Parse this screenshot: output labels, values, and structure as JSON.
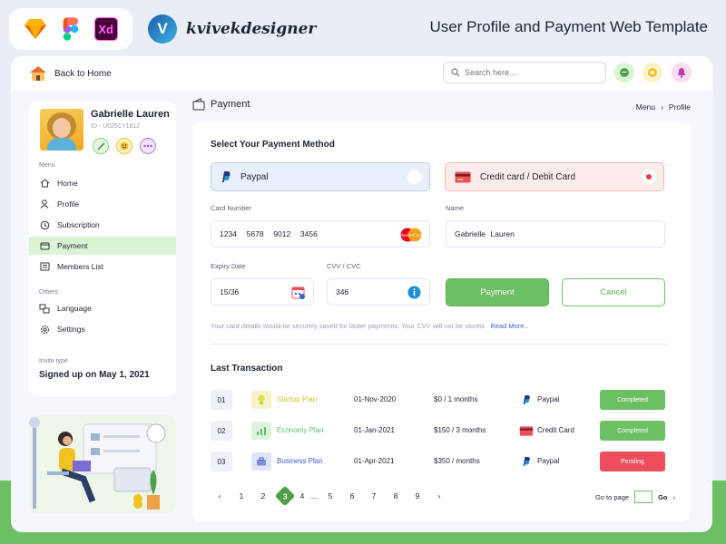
{
  "banner": {
    "tools": [
      "sketch-icon",
      "figma-icon",
      "xd-icon"
    ],
    "xd_label": "Xd",
    "brand_initial": "V",
    "brand_name": "kvivekdesigner",
    "title": "User Profile and Payment Web Template"
  },
  "topbar": {
    "back_label": "Back to Home",
    "search_placeholder": "Search here....",
    "icons": [
      "chat-icon",
      "gear-icon",
      "notification-icon"
    ]
  },
  "sidebar": {
    "user_name": "Gabrielle Lauren",
    "user_id": "ID - U0251Y1812",
    "menu_label": "Menu",
    "items": [
      {
        "label": "Home",
        "icon": "home-icon"
      },
      {
        "label": "Profile",
        "icon": "user-icon"
      },
      {
        "label": "Subscription",
        "icon": "subscription-icon"
      },
      {
        "label": "Payment",
        "icon": "wallet-icon"
      },
      {
        "label": "Members List",
        "icon": "list-icon"
      }
    ],
    "active_index": 3,
    "others_label": "Others",
    "others": [
      {
        "label": "Language",
        "icon": "language-icon"
      },
      {
        "label": "Settings",
        "icon": "gear-icon"
      }
    ],
    "invite_label": "Invite type",
    "invite_value": "Signed up on May 1, 2021"
  },
  "main": {
    "title": "Payment",
    "breadcrumb": [
      "Menu",
      "Profile"
    ],
    "select_method_title": "Select Your Payment Method",
    "methods": {
      "paypal": "Paypal",
      "card": "Credit card / Debit Card"
    },
    "card_number_label": "Card Number",
    "card_number_value": "1234  5678  9012  3456",
    "card_brand": "MasterCard",
    "name_label": "Name",
    "name_value": "Gabrielle Lauren",
    "expiry_label": "Expiry Date",
    "expiry_value": "15/36",
    "cvv_label": "CVV / CVC",
    "cvv_value": "346",
    "pay_button": "Payment",
    "cancel_button": "Cancel",
    "note": "Your card details would be securely saved for faster payments. Your CVV will not be stored.",
    "read_more": "Read More..",
    "last_tx_title": "Last Transaction",
    "transactions": [
      {
        "num": "01",
        "plan": "Startup Plan",
        "date": "01-Nov-2020",
        "amount": "$0 / 1 months",
        "method": "Paypal",
        "status": "Completed"
      },
      {
        "num": "02",
        "plan": "Economy Plan",
        "date": "01-Jan-2021",
        "amount": "$150 / 3 months",
        "method": "Credit Card",
        "status": "Completed"
      },
      {
        "num": "03",
        "plan": "Business Plan",
        "date": "01-Apr-2021",
        "amount": "$350 /  months",
        "method": "Paypal",
        "status": "Pending"
      }
    ],
    "colors": {
      "green": "#6cbf63",
      "red": "#ee4d5e",
      "startup": "#c9c52a",
      "economy": "#5fbf6b",
      "business": "#3b5bcc"
    },
    "pagination": [
      "1",
      "2",
      "3",
      "4",
      "....",
      "5",
      "6",
      "7",
      "8",
      "9"
    ],
    "current_page": "3",
    "goto_label": "Go to page",
    "go_label": "Go"
  }
}
